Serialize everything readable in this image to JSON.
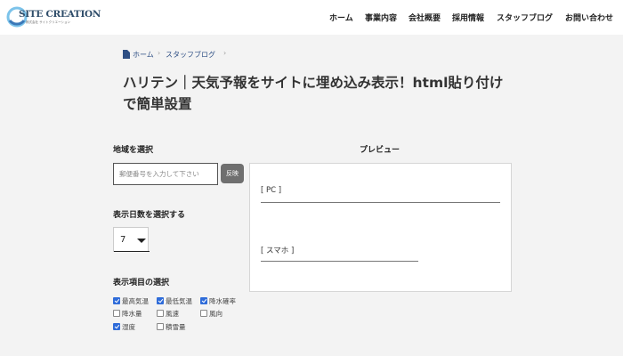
{
  "header": {
    "logo_text": "SITE CREATION",
    "logo_sub": "株式会社 サイトクリエーション",
    "nav": [
      {
        "label": "ホーム"
      },
      {
        "label": "事業内容"
      },
      {
        "label": "会社概要"
      },
      {
        "label": "採用情報"
      },
      {
        "label": "スタッフブログ"
      },
      {
        "label": "お問い合わせ"
      }
    ]
  },
  "breadcrumb": {
    "home": "ホーム",
    "blog": "スタッフブログ"
  },
  "page_title": "ハリテン｜天気予報をサイトに埋め込み表示！html貼り付けで簡単設置",
  "form": {
    "region_label": "地域を選択",
    "zip_placeholder": "郵便番号を入力して下さい",
    "reflect_button": "反映",
    "days_label": "表示日数を選択する",
    "days_value": "7",
    "items_label": "表示項目の選択",
    "items": [
      {
        "label": "最高気温",
        "checked": true
      },
      {
        "label": "最低気温",
        "checked": true
      },
      {
        "label": "降水確率",
        "checked": true
      },
      {
        "label": "降水量",
        "checked": false
      },
      {
        "label": "風速",
        "checked": false
      },
      {
        "label": "風向",
        "checked": false
      },
      {
        "label": "湿度",
        "checked": true
      },
      {
        "label": "積雪量",
        "checked": false
      }
    ]
  },
  "preview": {
    "title": "プレビュー",
    "pc_label": "[ PC ]",
    "sp_label": "[ スマホ ]"
  },
  "colors": {
    "logo_blue": "#2f4d6a",
    "logo_ring": "#7cc3ea",
    "link": "#2e4f84",
    "checkbox_on": "#2f6cd9",
    "button_gray": "#6f6f6f"
  }
}
